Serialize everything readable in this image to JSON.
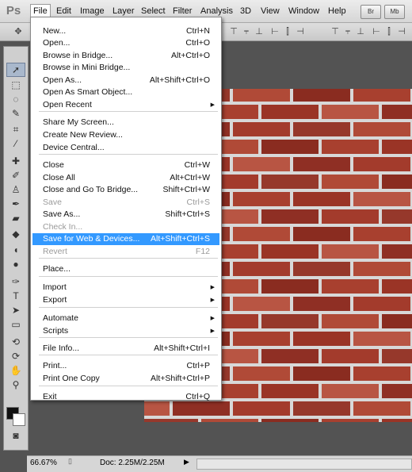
{
  "app": {
    "logo": "Ps"
  },
  "menubar": {
    "items": [
      "File",
      "Edit",
      "Image",
      "Layer",
      "Select",
      "Filter",
      "Analysis",
      "3D",
      "View",
      "Window",
      "Help"
    ],
    "buttons": [
      "Br",
      "Mb"
    ]
  },
  "file_menu": {
    "items": [
      {
        "label": "New...",
        "shortcut": "Ctrl+N"
      },
      {
        "label": "Open...",
        "shortcut": "Ctrl+O"
      },
      {
        "label": "Browse in Bridge...",
        "shortcut": "Alt+Ctrl+O"
      },
      {
        "label": "Browse in Mini Bridge...",
        "shortcut": ""
      },
      {
        "label": "Open As...",
        "shortcut": "Alt+Shift+Ctrl+O"
      },
      {
        "label": "Open As Smart Object...",
        "shortcut": ""
      },
      {
        "label": "Open Recent",
        "shortcut": "",
        "submenu": true
      },
      {
        "label": "Share My Screen...",
        "shortcut": ""
      },
      {
        "label": "Create New Review...",
        "shortcut": ""
      },
      {
        "label": "Device Central...",
        "shortcut": ""
      },
      {
        "label": "Close",
        "shortcut": "Ctrl+W"
      },
      {
        "label": "Close All",
        "shortcut": "Alt+Ctrl+W"
      },
      {
        "label": "Close and Go To Bridge...",
        "shortcut": "Shift+Ctrl+W"
      },
      {
        "label": "Save",
        "shortcut": "Ctrl+S",
        "disabled": true
      },
      {
        "label": "Save As...",
        "shortcut": "Shift+Ctrl+S"
      },
      {
        "label": "Check In...",
        "shortcut": "",
        "disabled": true
      },
      {
        "label": "Save for Web & Devices...",
        "shortcut": "Alt+Shift+Ctrl+S",
        "highlighted": true
      },
      {
        "label": "Revert",
        "shortcut": "F12",
        "disabled": true
      },
      {
        "label": "Place...",
        "shortcut": ""
      },
      {
        "label": "Import",
        "shortcut": "",
        "submenu": true
      },
      {
        "label": "Export",
        "shortcut": "",
        "submenu": true
      },
      {
        "label": "Automate",
        "shortcut": "",
        "submenu": true
      },
      {
        "label": "Scripts",
        "shortcut": "",
        "submenu": true
      },
      {
        "label": "File Info...",
        "shortcut": "Alt+Shift+Ctrl+I"
      },
      {
        "label": "Print...",
        "shortcut": "Ctrl+P"
      },
      {
        "label": "Print One Copy",
        "shortcut": "Alt+Shift+Ctrl+P"
      },
      {
        "label": "Exit",
        "shortcut": "Ctrl+Q"
      }
    ]
  },
  "status": {
    "zoom": "66.67%",
    "doc": "Doc: 2.25M/2.25M"
  },
  "colors": {
    "highlight": "#3399ff",
    "brick": "#a33b2c",
    "mortar": "#e2e2e2"
  }
}
